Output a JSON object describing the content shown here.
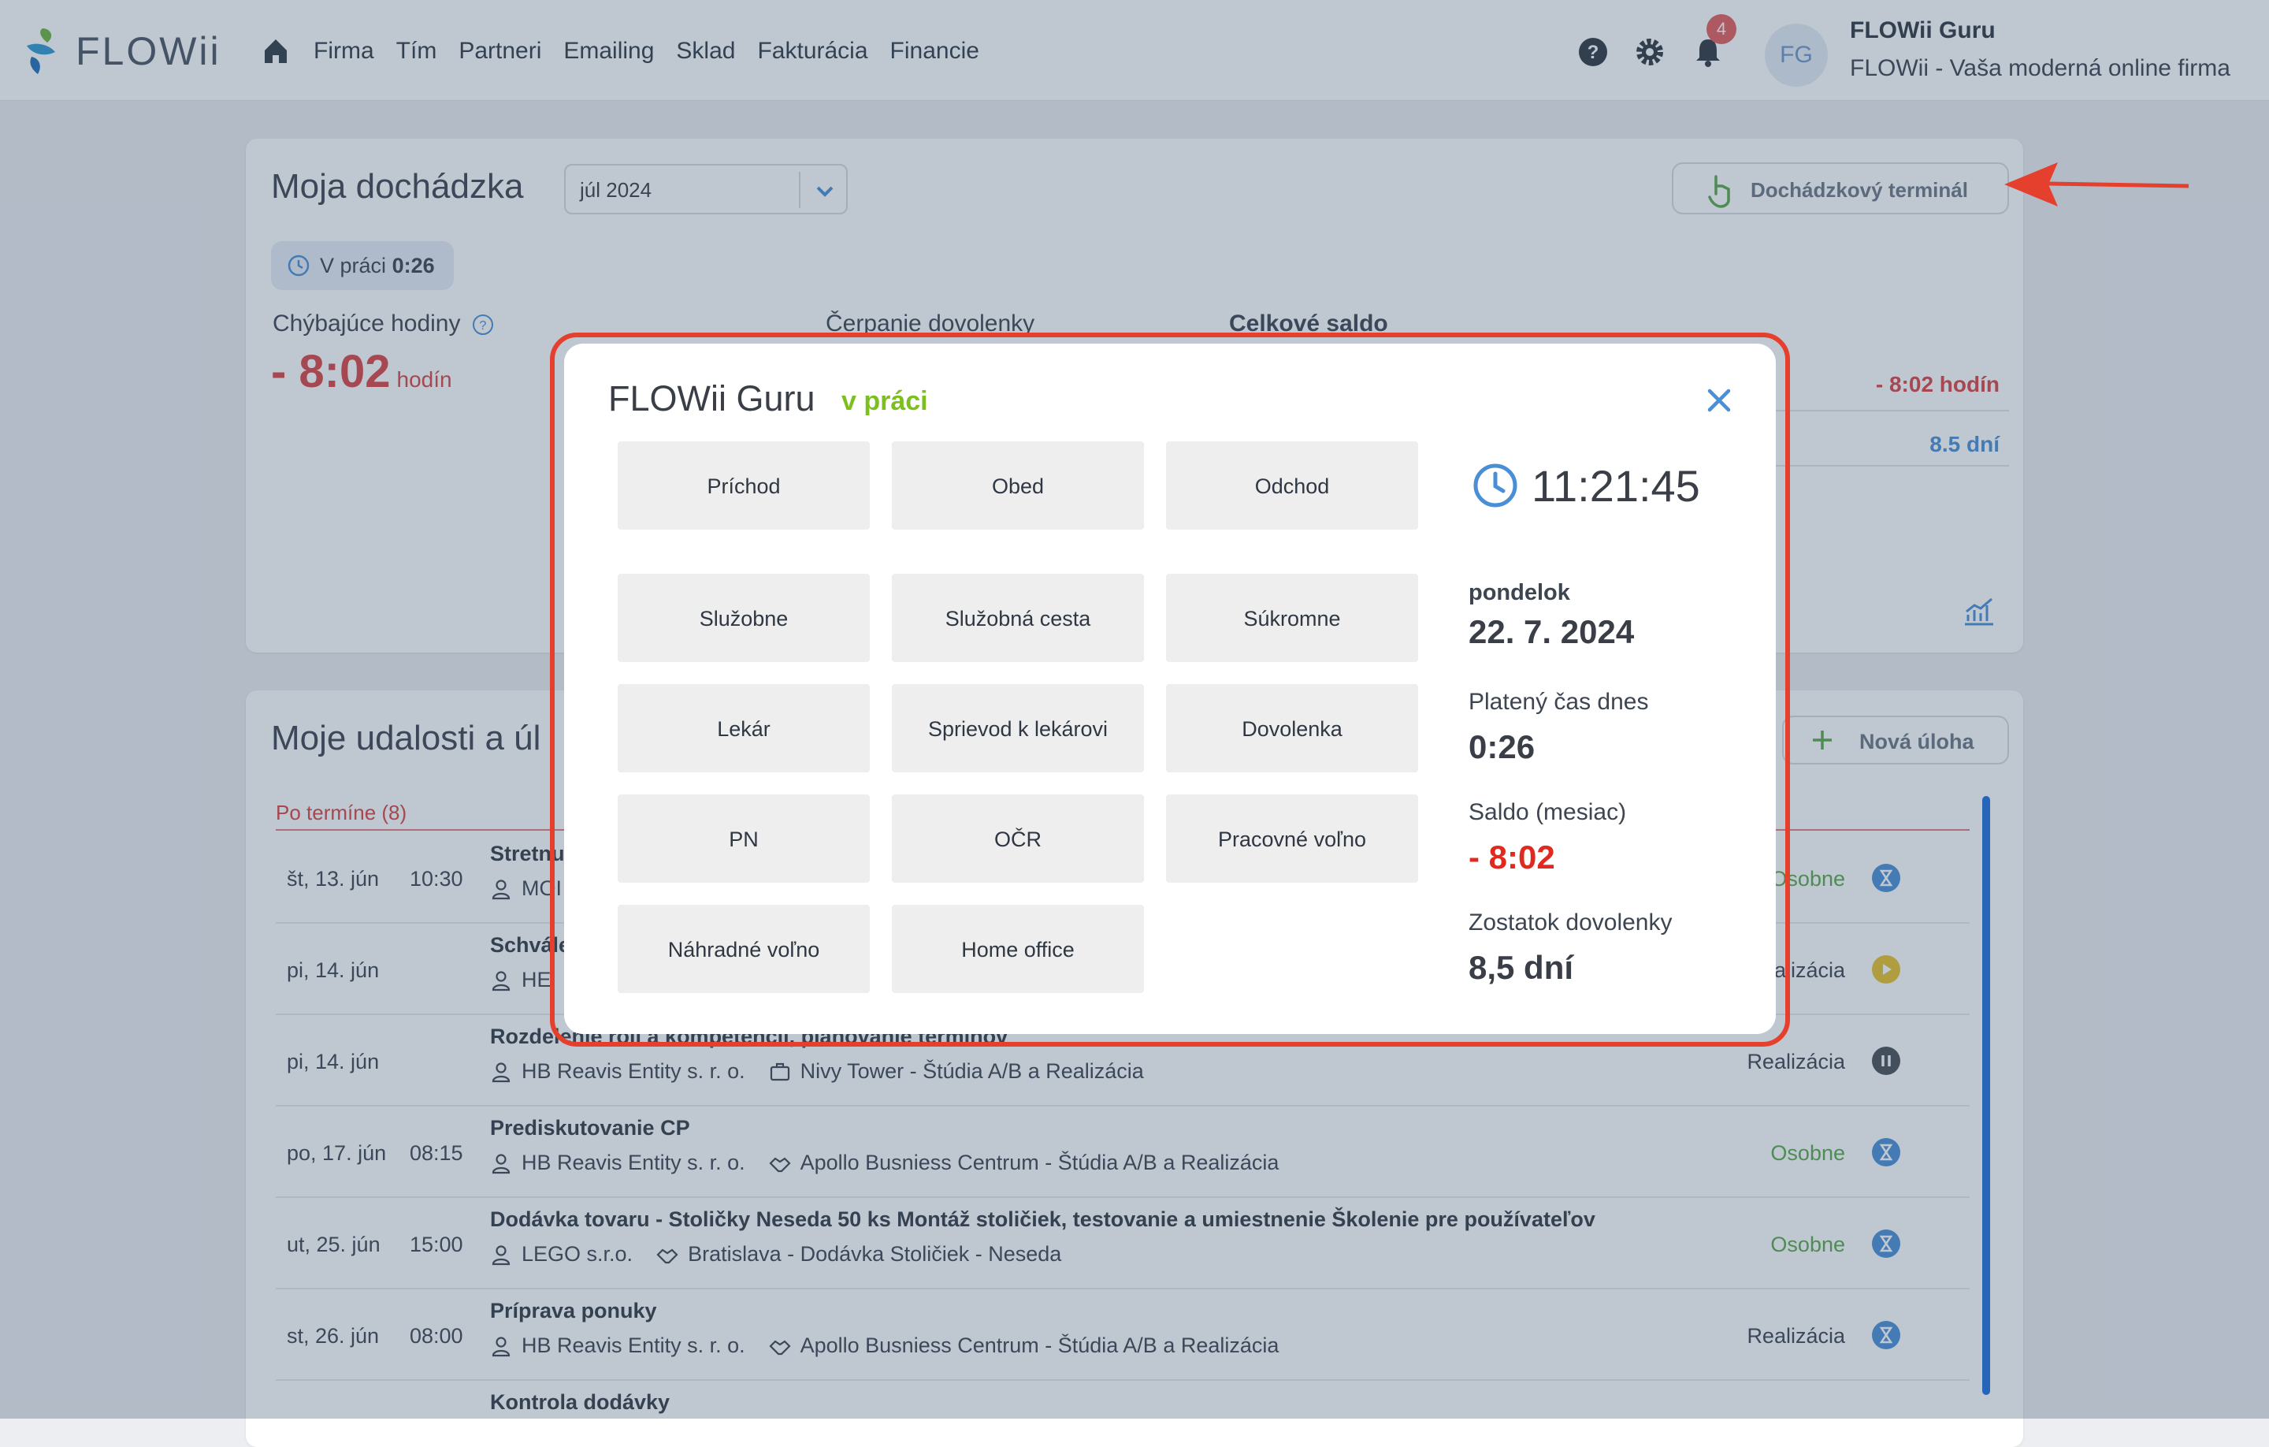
{
  "nav": {
    "logo_text": "FLOWii",
    "links": [
      "Firma",
      "Tím",
      "Partneri",
      "Emailing",
      "Sklad",
      "Fakturácia",
      "Financie"
    ],
    "notification_count": "4",
    "avatar_initials": "FG",
    "user_name": "FLOWii Guru",
    "user_company": "FLOWii - Vaša moderná online firma"
  },
  "attendance": {
    "title": "Moja dochádzka",
    "month": "júl 2024",
    "terminal_button": "Dochádzkový terminál",
    "in_work_label": "V práci",
    "in_work_value": "0:26",
    "missing_hours_label": "Chýbajúce hodiny",
    "missing_hours_value": "- 8:02",
    "missing_hours_unit": "hodín",
    "vacation_label": "Čerpanie dovolenky",
    "total_balance_label": "Celkové saldo",
    "right_value_1": "- 8:02 hodín",
    "right_value_2": "8.5 dní"
  },
  "events": {
    "title": "Moje udalosti a úl",
    "new_task_button": "Nová úloha",
    "overdue_label": "Po termíne (8)",
    "rows": [
      {
        "date": "št, 13. jún",
        "time": "10:30",
        "title": "Stretnu",
        "client": "MOI",
        "project": "",
        "category": "Osobne"
      },
      {
        "date": "pi, 14. jún",
        "time": "",
        "title": "Schvále",
        "client": "HE",
        "project": "",
        "category": "alizácia"
      },
      {
        "date": "pi, 14. jún",
        "time": "",
        "title": "Rozdelenie rolí a kompetencií, plánovanie termínov",
        "client": "HB Reavis Entity s. r. o.",
        "project": "Nivy Tower - Štúdia A/B a Realizácia",
        "category": "Realizácia"
      },
      {
        "date": "po, 17. jún",
        "time": "08:15",
        "title": "Prediskutovanie CP",
        "client": "HB Reavis Entity s. r. o.",
        "project": "Apollo Busniess Centrum - Štúdia A/B a Realizácia",
        "category": "Osobne"
      },
      {
        "date": "ut, 25. jún",
        "time": "15:00",
        "title": "Dodávka tovaru - Stoličky Neseda 50 ks Montáž stoličiek, testovanie a umiestnenie Školenie pre používateľov",
        "client": "LEGO s.r.o.",
        "project": "Bratislava - Dodávka Stoličiek - Neseda",
        "category": "Osobne"
      },
      {
        "date": "st, 26. jún",
        "time": "08:00",
        "title": "Príprava ponuky",
        "client": "HB Reavis Entity s. r. o.",
        "project": "Apollo Busniess Centrum - Štúdia A/B a Realizácia",
        "category": "Realizácia"
      },
      {
        "date": "",
        "time": "",
        "title": "Kontrola dodávky",
        "client": "",
        "project": "",
        "category": ""
      }
    ]
  },
  "modal": {
    "user": "FLOWii Guru",
    "status": "v práci",
    "buttons": [
      "Príchod",
      "Obed",
      "Odchod",
      "Služobne",
      "Služobná cesta",
      "Súkromne",
      "Lekár",
      "Sprievod k lekárovi",
      "Dovolenka",
      "PN",
      "OČR",
      "Pracovné voľno",
      "Náhradné voľno",
      "Home office"
    ],
    "time": "11:21:45",
    "day": "pondelok",
    "date": "22. 7. 2024",
    "paid_time_label": "Platený čas dnes",
    "paid_time_value": "0:26",
    "balance_label": "Saldo (mesiac)",
    "balance_value": "- 8:02",
    "vacation_left_label": "Zostatok dovolenky",
    "vacation_left_value": "8,5 dní"
  },
  "colors": {
    "accent_blue": "#4a8fd6",
    "negative_red": "#d94444",
    "status_green": "#7dbf1f",
    "highlight_red": "#e5402e"
  }
}
